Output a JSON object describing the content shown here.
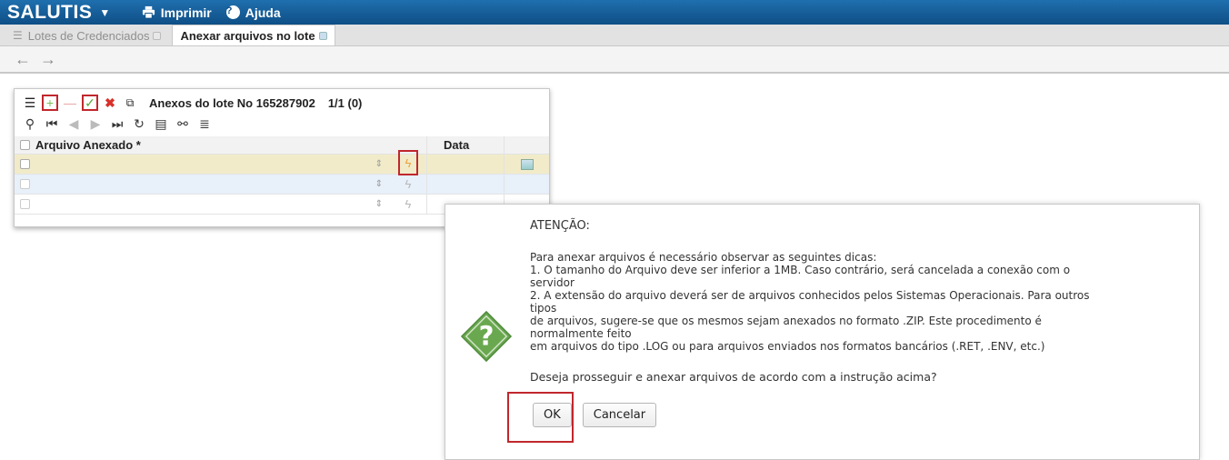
{
  "topbar": {
    "brand": "SALUTIS",
    "brand_caret": "▼",
    "menu": [
      {
        "label": "Imprimir",
        "icon": "printer-icon"
      },
      {
        "label": "Ajuda",
        "icon": "help-icon"
      }
    ]
  },
  "tabs": [
    {
      "label": "Lotes de Credenciados",
      "active": false
    },
    {
      "label": "Anexar arquivos no lote",
      "active": true
    }
  ],
  "nav": {
    "back": "←",
    "forward": "→"
  },
  "panel": {
    "title": "Anexos do lote No 165287902",
    "pager": "1/1 (0)",
    "columns": [
      "Arquivo Anexado *",
      "Data"
    ],
    "rows": [
      {
        "file": "",
        "date": "",
        "state": "selected"
      },
      {
        "file": "",
        "date": "",
        "state": "normal"
      },
      {
        "file": "",
        "date": "",
        "state": "normal"
      }
    ]
  },
  "dialog": {
    "heading": "ATENÇÃO:",
    "lines": [
      "Para anexar arquivos é necessário observar as seguintes dicas:",
      "1. O tamanho do Arquivo deve ser inferior a 1MB. Caso contrário, será cancelada a conexão com o",
      "servidor",
      "2. A extensão do arquivo deverá ser de arquivos conhecidos pelos Sistemas Operacionais. Para outros",
      "tipos",
      "de arquivos, sugere-se que os mesmos sejam anexados no formato .ZIP. Este procedimento é",
      "normalmente feito",
      "em arquivos do tipo .LOG ou para arquivos enviados nos formatos bancários (.RET, .ENV, etc.)"
    ],
    "question": "Deseja prosseguir e anexar arquivos de acordo com a instrução acima?",
    "ok_label": "OK",
    "cancel_label": "Cancelar"
  },
  "colors": {
    "topbar": "#1a62a0",
    "highlight": "#c0272d",
    "selected_row": "#f1ebc9",
    "accent_green": "#6aa84f"
  }
}
